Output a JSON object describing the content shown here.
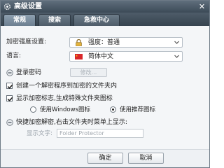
{
  "window": {
    "title": "高级设置",
    "close_glyph": "✕"
  },
  "tabs": [
    {
      "label": "常规",
      "active": true
    },
    {
      "label": "搜索",
      "active": false
    },
    {
      "label": "急救中心",
      "active": false
    }
  ],
  "general": {
    "encryption_strength_label": "加密强度设置:",
    "encryption_strength_value": "强度：普通",
    "language_label": "语言:",
    "language_value": "简体中文",
    "login_password_label": "登录密码",
    "modify_button_label": "修改...",
    "create_decrypt_label": "创建一个解密程序到加密的文件夹内",
    "create_decrypt_checked": true,
    "show_marker_label": "显示加密标志,生成特殊文件夹图标",
    "show_marker_checked": true,
    "radio_windows_label": "使用Windows图标",
    "radio_windows_selected": false,
    "radio_recommended_label": "使用推荐图标",
    "radio_recommended_selected": true,
    "quick_encrypt_label": "快捷加密解密,右击文件夹时菜单上显示:",
    "display_text_label": "显示文字:",
    "display_text_placeholder": "Folder Protector"
  },
  "footer": {
    "ok_label": "确定",
    "cancel_label": "取消"
  },
  "colors": {
    "titlebar": "#3c4a57",
    "accent_red": "#d8282b",
    "flag_yellow": "#ffde00"
  }
}
